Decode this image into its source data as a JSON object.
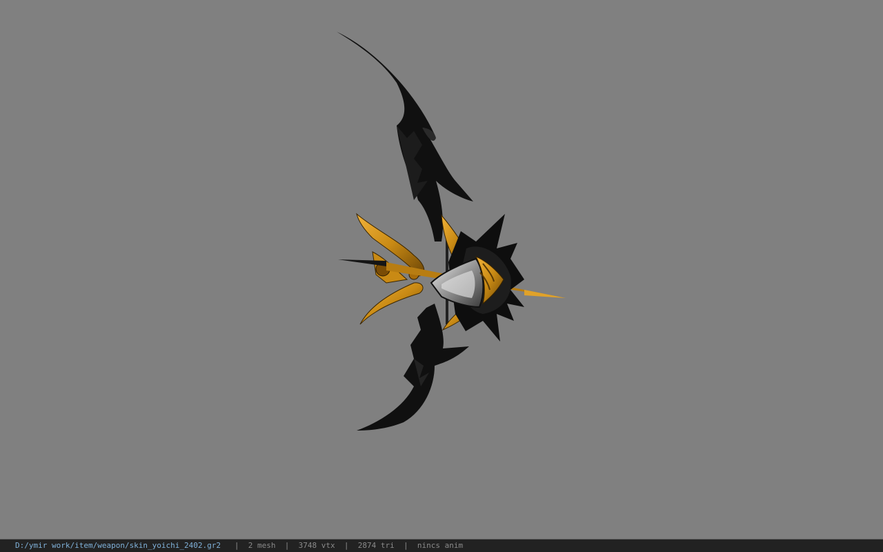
{
  "viewport": {
    "background": "#808080",
    "model_name": "skin_yoichi_2402"
  },
  "status_bar": {
    "file_path": "D:/ymir work/item/weapon/skin_yoichi_2402.gr2",
    "separator": "|",
    "mesh_count": "2 mesh",
    "vertex_count": "3748 vtx",
    "triangle_count": "2874 tri",
    "animation": "nincs anim",
    "path_color": "#7fb0d8",
    "text_color": "#8a8a8a"
  },
  "icons": {
    "model": "bow-model-icon"
  }
}
